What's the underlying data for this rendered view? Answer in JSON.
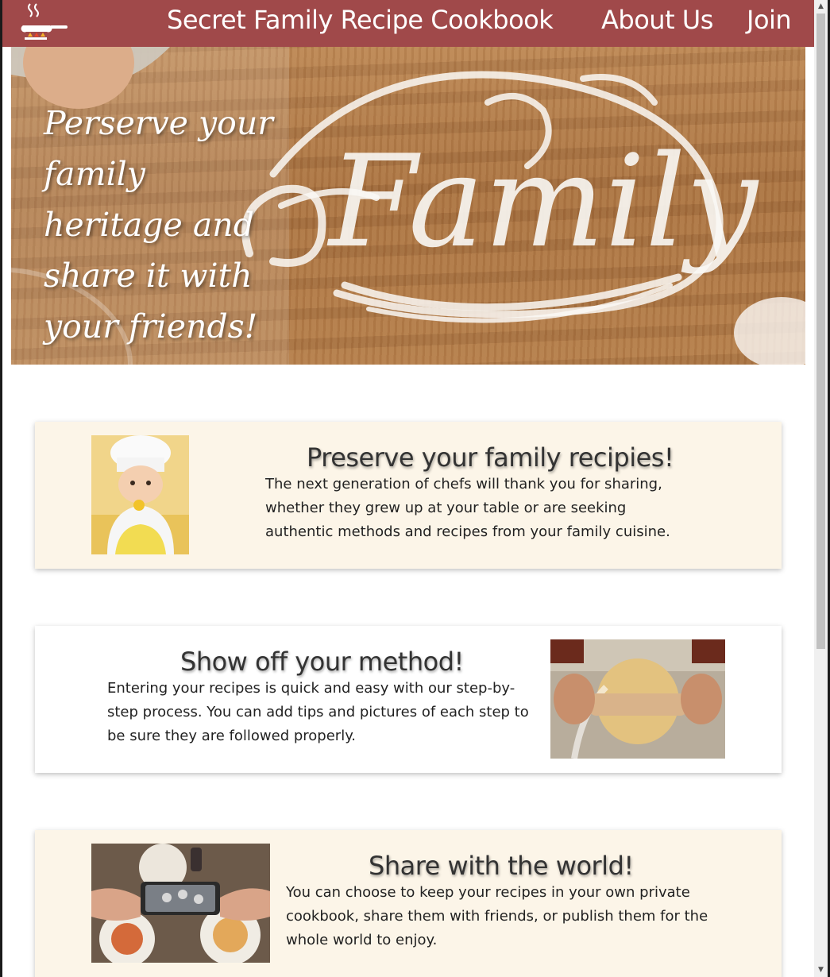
{
  "header": {
    "site_title": "Secret Family Recipe Cookbook",
    "nav": [
      {
        "label": "About Us"
      },
      {
        "label": "Join"
      }
    ]
  },
  "hero": {
    "tagline": "Perserve your family heritage and share it with your friends!",
    "flour_word": "Family"
  },
  "features": [
    {
      "title": "Preserve your family recipies!",
      "body": "The next generation of chefs will thank you for sharing, whether they grew up at your table or are seeking authentic methods and recipes from your family cuisine."
    },
    {
      "title": "Show off your method!",
      "body": "Entering your recipes is quick and easy with our step-by-step process. You can add tips and pictures of each step to be sure they are followed properly."
    },
    {
      "title": "Share with the world!",
      "body": "You can choose to keep your recipes in your own private cookbook, share them with friends, or publish them for the whole world to enjoy."
    }
  ],
  "colors": {
    "header_bg": "#a0494a",
    "card_cream": "#fcf5e8",
    "text": "#222222"
  },
  "icons": {
    "logo": "steaming-pan-icon"
  }
}
